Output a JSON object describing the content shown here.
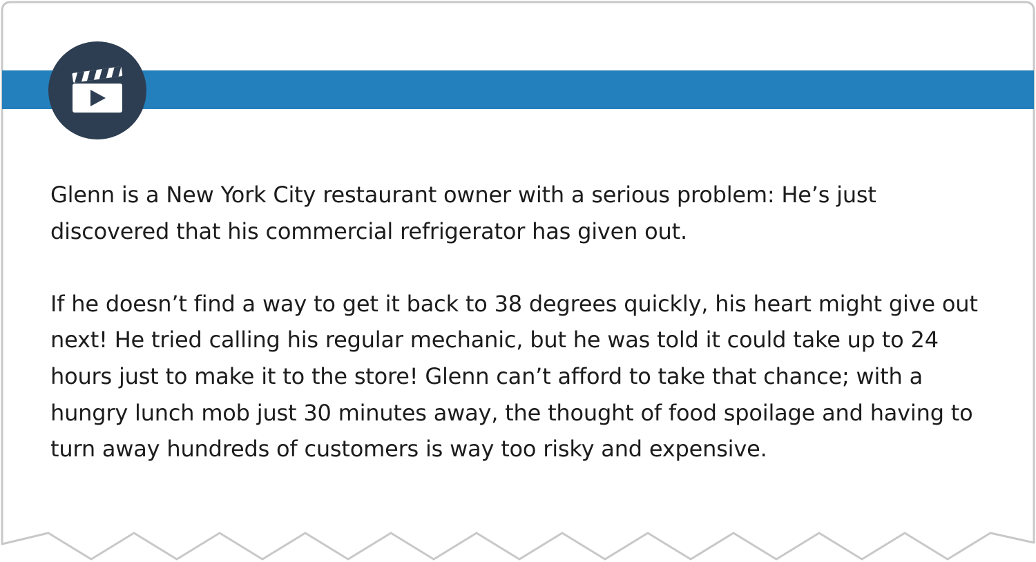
{
  "card": {
    "paragraphs": [
      "Glenn is a New York City restaurant owner with a serious problem: He’s just discovered that his commercial refrigerator has given out.",
      "If he doesn’t find a way to get it back to 38 degrees quickly, his heart might give out next! He tried calling his regular mechanic, but he was told it could take up to 24 hours just to make it to the store! Glenn can’t afford to take that chance; with a hungry lunch mob just 30 minutes away, the thought of food spoilage and having to turn away hundreds of customers is way too risky and expensive."
    ]
  },
  "icons": {
    "badge": "video-clapperboard-icon"
  },
  "colors": {
    "accent_bar": "#2480bd",
    "badge_bg": "#2d3e52",
    "icon_fg": "#ffffff",
    "border": "#c8c8c8",
    "text": "#1c1c1c"
  }
}
